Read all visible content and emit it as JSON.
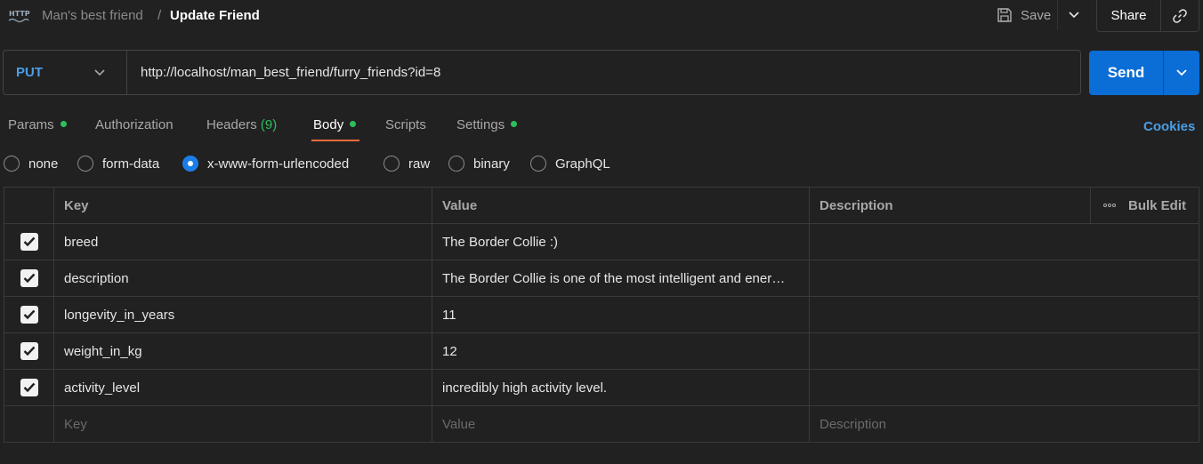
{
  "header": {
    "breadcrumb_parent": "Man's best friend",
    "breadcrumb_separator": "/",
    "request_title": "Update Friend",
    "save_label": "Save",
    "share_label": "Share"
  },
  "request": {
    "method": "PUT",
    "url": "http://localhost/man_best_friend/furry_friends?id=8",
    "send_label": "Send"
  },
  "tabs": [
    {
      "label": "Params",
      "dot": true
    },
    {
      "label": "Authorization",
      "dot": false
    },
    {
      "label": "Headers",
      "count": "(9)",
      "dot": false
    },
    {
      "label": "Body",
      "dot": true,
      "active": true
    },
    {
      "label": "Scripts",
      "dot": false
    },
    {
      "label": "Settings",
      "dot": true
    }
  ],
  "cookies_label": "Cookies",
  "body_types": [
    {
      "label": "none",
      "selected": false
    },
    {
      "label": "form-data",
      "selected": false
    },
    {
      "label": "x-www-form-urlencoded",
      "selected": true
    },
    {
      "label": "raw",
      "selected": false
    },
    {
      "label": "binary",
      "selected": false
    },
    {
      "label": "GraphQL",
      "selected": false
    }
  ],
  "table": {
    "columns": {
      "key": "Key",
      "value": "Value",
      "description": "Description",
      "bulk_edit": "Bulk Edit"
    },
    "rows": [
      {
        "checked": true,
        "key": "breed",
        "value": "The Border Collie :)",
        "description": ""
      },
      {
        "checked": true,
        "key": "description",
        "value": "The Border Collie is one of the most intelligent and ener…",
        "description": ""
      },
      {
        "checked": true,
        "key": "longevity_in_years",
        "value": "11",
        "description": ""
      },
      {
        "checked": true,
        "key": "weight_in_kg",
        "value": "12",
        "description": ""
      },
      {
        "checked": true,
        "key": "activity_level",
        "value": "incredibly high activity level.",
        "description": ""
      }
    ],
    "placeholders": {
      "key": "Key",
      "value": "Value",
      "description": "Description"
    }
  },
  "colors": {
    "background": "#212121",
    "accent_blue": "#0b6dd6",
    "method_color": "#4a9ee6",
    "active_tab_underline": "#ef6b3a",
    "dot_green": "#2cbf5b"
  }
}
